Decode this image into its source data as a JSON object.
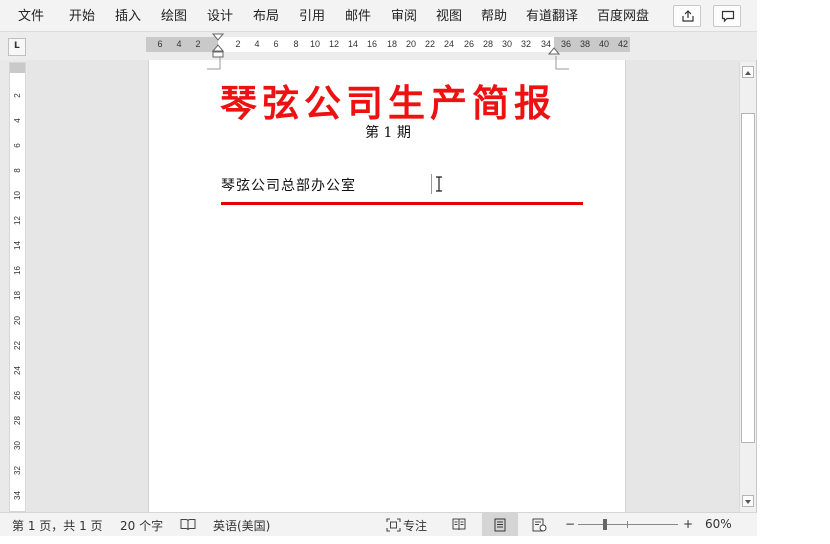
{
  "menubar": {
    "tabs": [
      "文件",
      "开始",
      "插入",
      "绘图",
      "设计",
      "布局",
      "引用",
      "邮件",
      "审阅",
      "视图",
      "帮助",
      "有道翻译",
      "百度网盘"
    ],
    "share_icon": "share-icon",
    "comment_icon": "comment-icon"
  },
  "ruler": {
    "corner_label": "L",
    "left_ticks": [
      "6",
      "4",
      "2"
    ],
    "main_ticks": [
      "2",
      "4",
      "6",
      "8",
      "10",
      "12",
      "14",
      "16",
      "18",
      "20",
      "22",
      "24",
      "26",
      "28",
      "30",
      "32",
      "34"
    ],
    "right_ticks": [
      "36",
      "38",
      "40",
      "42"
    ],
    "vertical_ticks": [
      "2",
      "4",
      "6",
      "8",
      "10",
      "12",
      "14",
      "16",
      "18",
      "20",
      "22",
      "24",
      "26",
      "28",
      "30",
      "32",
      "34"
    ]
  },
  "document": {
    "title": "琴弦公司生产简报",
    "issue": "第 1 期",
    "department": "琴弦公司总部办公室",
    "title_color": "#ee1111",
    "rule_color": "#e60000"
  },
  "statusbar": {
    "page_info": "第 1 页，共 1 页",
    "word_count": "20 个字",
    "language": "英语(美国)",
    "focus_label": "专注",
    "zoom_minus": "−",
    "zoom_plus": "+",
    "zoom_level": "60%",
    "zoom_value": 0.6
  }
}
